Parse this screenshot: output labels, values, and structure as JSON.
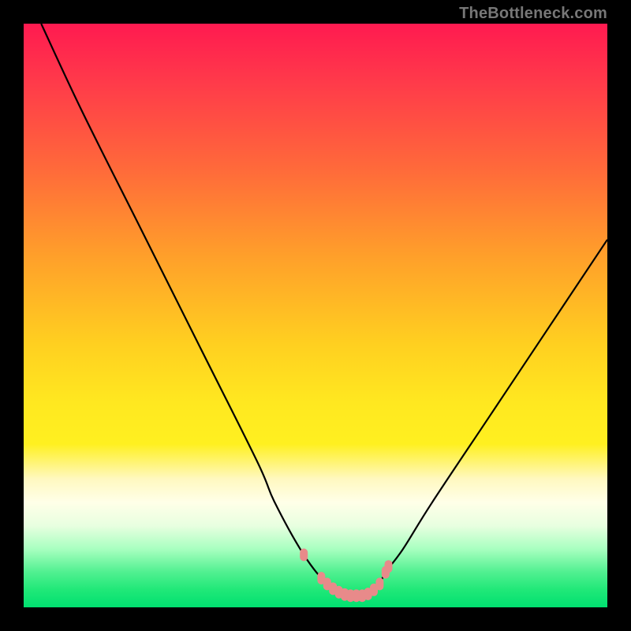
{
  "attribution": "TheBottleneck.com",
  "chart_data": {
    "type": "line",
    "title": "",
    "xlabel": "",
    "ylabel": "",
    "xlim": [
      0,
      100
    ],
    "ylim": [
      0,
      100
    ],
    "series": [
      {
        "name": "bottleneck-curve",
        "x": [
          3,
          10,
          20,
          30,
          40,
          43,
          48,
          52,
          55,
          57,
          58,
          60,
          61,
          62,
          65,
          70,
          80,
          90,
          100
        ],
        "y": [
          100,
          85,
          65,
          45,
          25,
          18,
          9,
          4,
          2,
          2,
          2,
          3,
          4,
          6,
          10,
          18,
          33,
          48,
          63
        ]
      }
    ],
    "markers": {
      "name": "highlight-points",
      "color": "#e88a8a",
      "x": [
        48,
        51,
        52,
        53,
        54,
        55,
        56,
        57,
        58,
        59,
        60,
        61,
        62,
        62.5
      ],
      "y": [
        9,
        5,
        4,
        3.2,
        2.6,
        2.2,
        2,
        2,
        2,
        2.3,
        3,
        4,
        6,
        7
      ]
    }
  }
}
